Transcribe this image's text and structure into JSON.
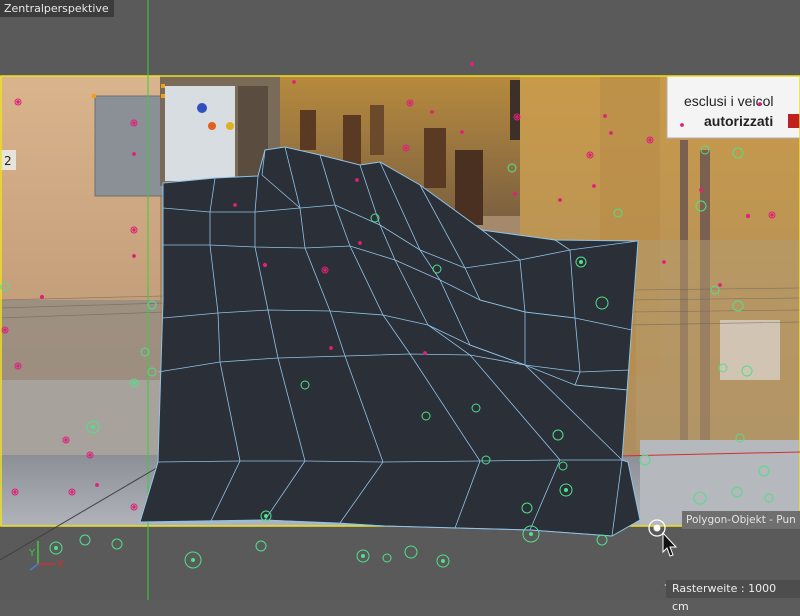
{
  "viewport": {
    "title": "Zentralperspektive",
    "status_label": "Polygon-Objekt - Pun",
    "grid_label": "Rasterweite : 1000 cm"
  },
  "photo": {
    "sign": {
      "line1": "esclusi i veicol",
      "line2": "autorizzati"
    },
    "house_number": "2"
  },
  "axes": {
    "y_label": "Y",
    "x_label": "X"
  },
  "colors": {
    "viewport_bg": "#5a5a5a",
    "frame_yellow": "#f0e020",
    "mesh_fill": "#2b2f37",
    "mesh_edges": "#8fc3e8",
    "point_magenta": "#e0207a",
    "point_green": "#4fe08a",
    "y_axis_green": "#3dcc3d",
    "x_axis_red": "#d03030"
  },
  "icons": {
    "cursor": "mouse-pointer-icon",
    "axis_gizmo": "axis-gizmo-icon"
  }
}
